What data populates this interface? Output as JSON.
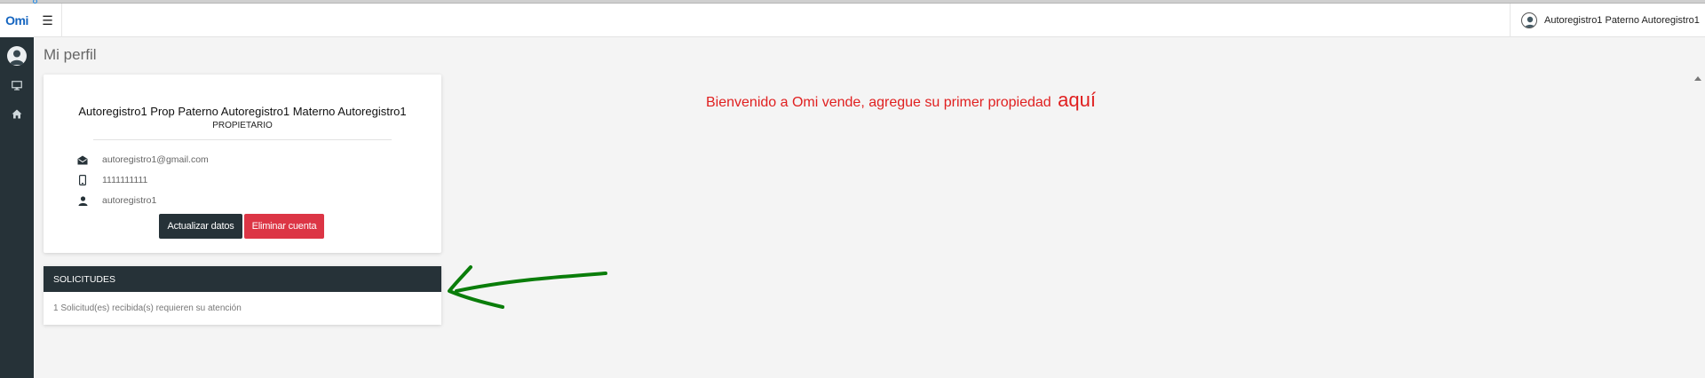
{
  "app": {
    "logo_text": "Omi",
    "brand_color": "#1565c0",
    "sidebar_color": "#263238"
  },
  "sidebar": {
    "items": [
      {
        "icon": "avatar-icon"
      },
      {
        "icon": "monitor-icon"
      },
      {
        "icon": "home-icon"
      }
    ]
  },
  "header": {
    "menu_icon": "☰",
    "user_name": "Autoregistro1 Paterno Autoregistro1"
  },
  "page": {
    "title": "Mi perfil"
  },
  "profile": {
    "full_name": "Autoregistro1 Prop Paterno Autoregistro1 Materno Autoregistro1",
    "role": "PROPIETARIO",
    "email": "autoregistro1@gmail.com",
    "phone": "1111111111",
    "username": "autoregistro1",
    "update_label": "Actualizar datos",
    "delete_label": "Eliminar cuenta"
  },
  "requests": {
    "header": "SOLICITUDES",
    "message": "1 Solicitud(es) recibida(s) requieren su atención"
  },
  "welcome": {
    "text": "Bienvenido a Omi vende, agregue su primer propiedad",
    "link": "aquí",
    "color": "#e02020"
  },
  "colors": {
    "danger": "#dc3545",
    "dark": "#263238",
    "annotation_arrow": "#0a7d0a"
  }
}
